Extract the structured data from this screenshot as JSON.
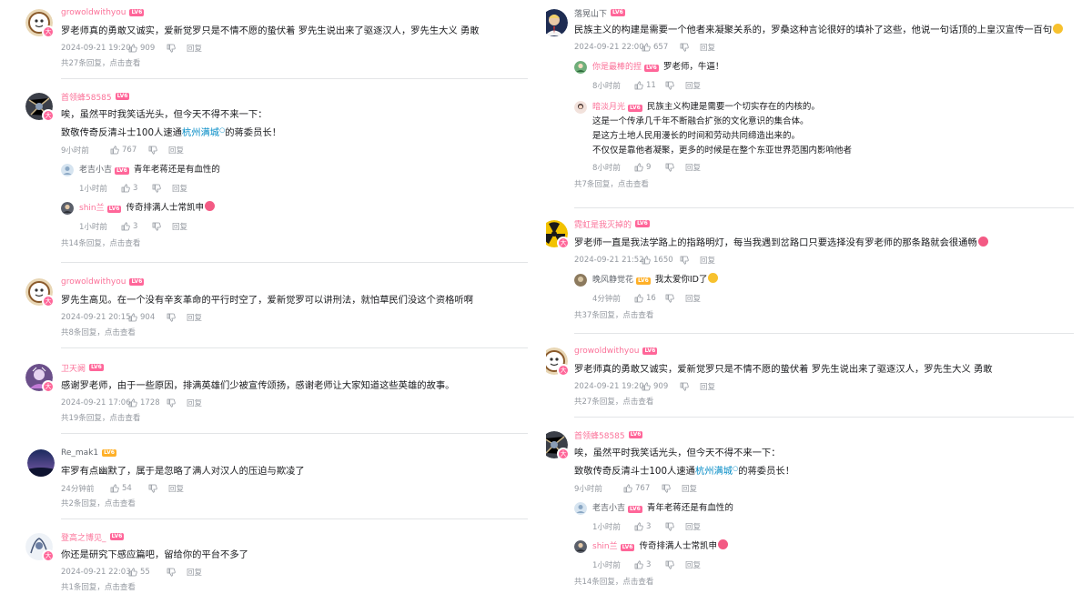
{
  "lv_label": "LV6",
  "left": [
    {
      "user": "growoldwithyou",
      "text": "罗老师真的勇敢又诚实，爱新觉罗只是不情不愿的蛰伏着 罗先生说出来了驱逐汉人，罗先生大义 勇敢",
      "time": "2024-09-21 19:20",
      "likes": "909",
      "reply": "回复",
      "more": "共27条回复，点击查看"
    },
    {
      "user": "首领蜂58585",
      "text_line1": "唉，虽然平时我笑话光头，但今天不得不来一下：",
      "text_line2_pre": "致敬传奇反清斗士100人速通",
      "text_line2_link": "杭州满城",
      "text_line2_post": "的蒋委员长！",
      "time": "9小时前",
      "likes": "767",
      "reply": "回复",
      "subs": [
        {
          "user": "老吉小吉",
          "text": "青年老蒋还是有血性的",
          "time": "1小时前",
          "likes": "3",
          "reply": "回复"
        },
        {
          "user": "shin兰",
          "text": "传奇排满人士常凯申",
          "time": "1小时前",
          "likes": "3",
          "reply": "回复"
        }
      ],
      "more": "共14条回复，点击查看"
    },
    {
      "user": "growoldwithyou",
      "text": "罗先生高见。在一个没有辛亥革命的平行时空了，爱新觉罗可以讲刑法，就怕草民们没这个资格听啊",
      "time": "2024-09-21 20:15",
      "likes": "904",
      "reply": "回复",
      "more": "共8条回复，点击查看"
    },
    {
      "user": "卫天阙",
      "text": "感谢罗老师，由于一些原因，排满英雄们少被宣传颂扬，感谢老师让大家知道这些英雄的故事。",
      "time": "2024-09-21 17:06",
      "likes": "1728",
      "reply": "回复",
      "more": "共19条回复，点击查看"
    },
    {
      "user": "Re_mak1",
      "text": "牢罗有点幽默了，属于是忽略了满人对汉人的压迫与欺凌了",
      "time": "24分钟前",
      "likes": "54",
      "reply": "回复",
      "more": "共2条回复，点击查看"
    },
    {
      "user": "登高之博见_",
      "text": "你还是研究下感应篇吧，留给你的平台不多了",
      "time": "2024-09-21 22:03",
      "likes": "55",
      "reply": "回复",
      "more": "共1条回复，点击查看"
    }
  ],
  "right": [
    {
      "user": "落晃山下",
      "text": "民族主义的构建是需要一个他者来凝聚关系的，罗桑这种言论很好的填补了这些，他说一句话顶的上皇汉宣传一百句",
      "time": "2024-09-21 22:00",
      "likes": "657",
      "reply": "回复",
      "subs": [
        {
          "user": "你是最棒的捏",
          "text": "罗老师，牛逼！",
          "time": "8小时前",
          "likes": "11",
          "reply": "回复"
        },
        {
          "user": "暗淡月光",
          "text": "民族主义构建是需要一个切实存在的内核的。",
          "lines": [
            "这是一个传承几千年不断融合扩张的文化意识的集合体。",
            "是这方土地人民用漫长的时间和劳动共同缔造出来的。",
            "不仅仅是靠他者凝聚，更多的时候是在整个东亚世界范围内影响他者"
          ],
          "time": "8小时前",
          "likes": "9",
          "reply": "回复"
        }
      ],
      "more": "共7条回复，点击查看"
    },
    {
      "user": "霓虹是我灭掉的",
      "text": "罗老师一直是我法学路上的指路明灯，每当我遇到岔路口只要选择没有罗老师的那条路就会很通畅",
      "time": "2024-09-21 21:52",
      "likes": "1650",
      "reply": "回复",
      "subs": [
        {
          "user": "晚风静觉花",
          "text": "我太爱你ID了",
          "time": "4分钟前",
          "likes": "16",
          "reply": "回复"
        }
      ],
      "more": "共37条回复，点击查看"
    },
    {
      "user": "growoldwithyou",
      "text": "罗老师真的勇敢又诚实，爱新觉罗只是不情不愿的蛰伏着 罗先生说出来了驱逐汉人，罗先生大义 勇敢",
      "time": "2024-09-21 19:20",
      "likes": "909",
      "reply": "回复",
      "more": "共27条回复，点击查看"
    },
    {
      "user": "首领蜂58585",
      "text_line1": "唉，虽然平时我笑话光头，但今天不得不来一下：",
      "text_line2_pre": "致敬传奇反清斗士100人速通",
      "text_line2_link": "杭州满城",
      "text_line2_post": "的蒋委员长！",
      "time": "9小时前",
      "likes": "767",
      "reply": "回复",
      "subs": [
        {
          "user": "老吉小吉",
          "text": "青年老蒋还是有血性的",
          "time": "1小时前",
          "likes": "3",
          "reply": "回复"
        },
        {
          "user": "shin兰",
          "text": "传奇排满人士常凯申",
          "time": "1小时前",
          "likes": "3",
          "reply": "回复"
        }
      ],
      "more": "共14条回复，点击查看"
    }
  ]
}
